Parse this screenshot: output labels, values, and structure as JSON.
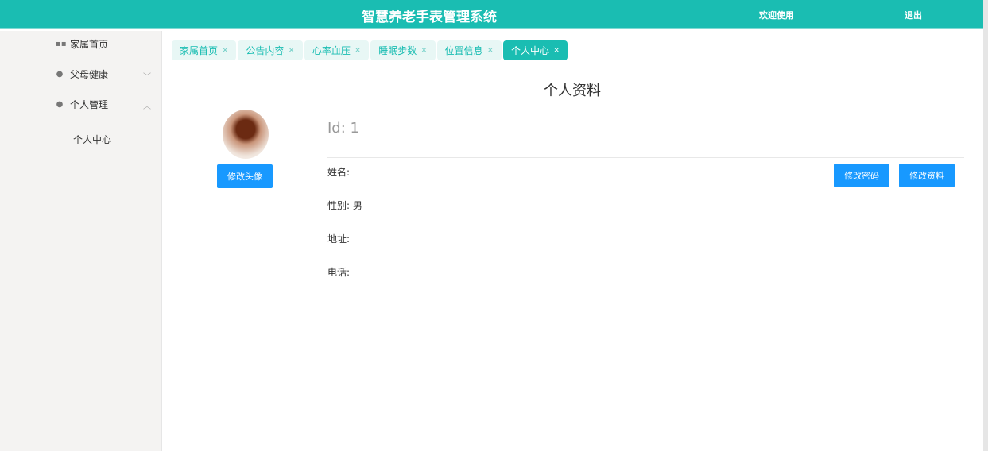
{
  "header": {
    "title": "智慧养老手表管理系统",
    "welcome": "欢迎使用",
    "logout": "退出"
  },
  "sidebar": {
    "items": [
      {
        "label": "家属首页",
        "icon": "grid-icon"
      },
      {
        "label": "父母健康",
        "icon": "location-icon"
      },
      {
        "label": "个人管理",
        "icon": "location-icon"
      }
    ],
    "sub": "个人中心"
  },
  "tabs": [
    {
      "label": "家属首页"
    },
    {
      "label": "公告内容"
    },
    {
      "label": "心率血压"
    },
    {
      "label": "睡眠步数"
    },
    {
      "label": "位置信息"
    },
    {
      "label": "个人中心",
      "active": true
    }
  ],
  "tab_close": "×",
  "profile": {
    "title": "个人资料",
    "id": "Id: 1",
    "change_avatar": "修改头像",
    "change_password": "修改密码",
    "edit_profile": "修改资料",
    "name": "姓名:",
    "gender": "性别: 男",
    "address": "地址:",
    "phone": "电话:"
  },
  "colors": {
    "primary": "#1abdb2",
    "button": "#1899ff"
  }
}
